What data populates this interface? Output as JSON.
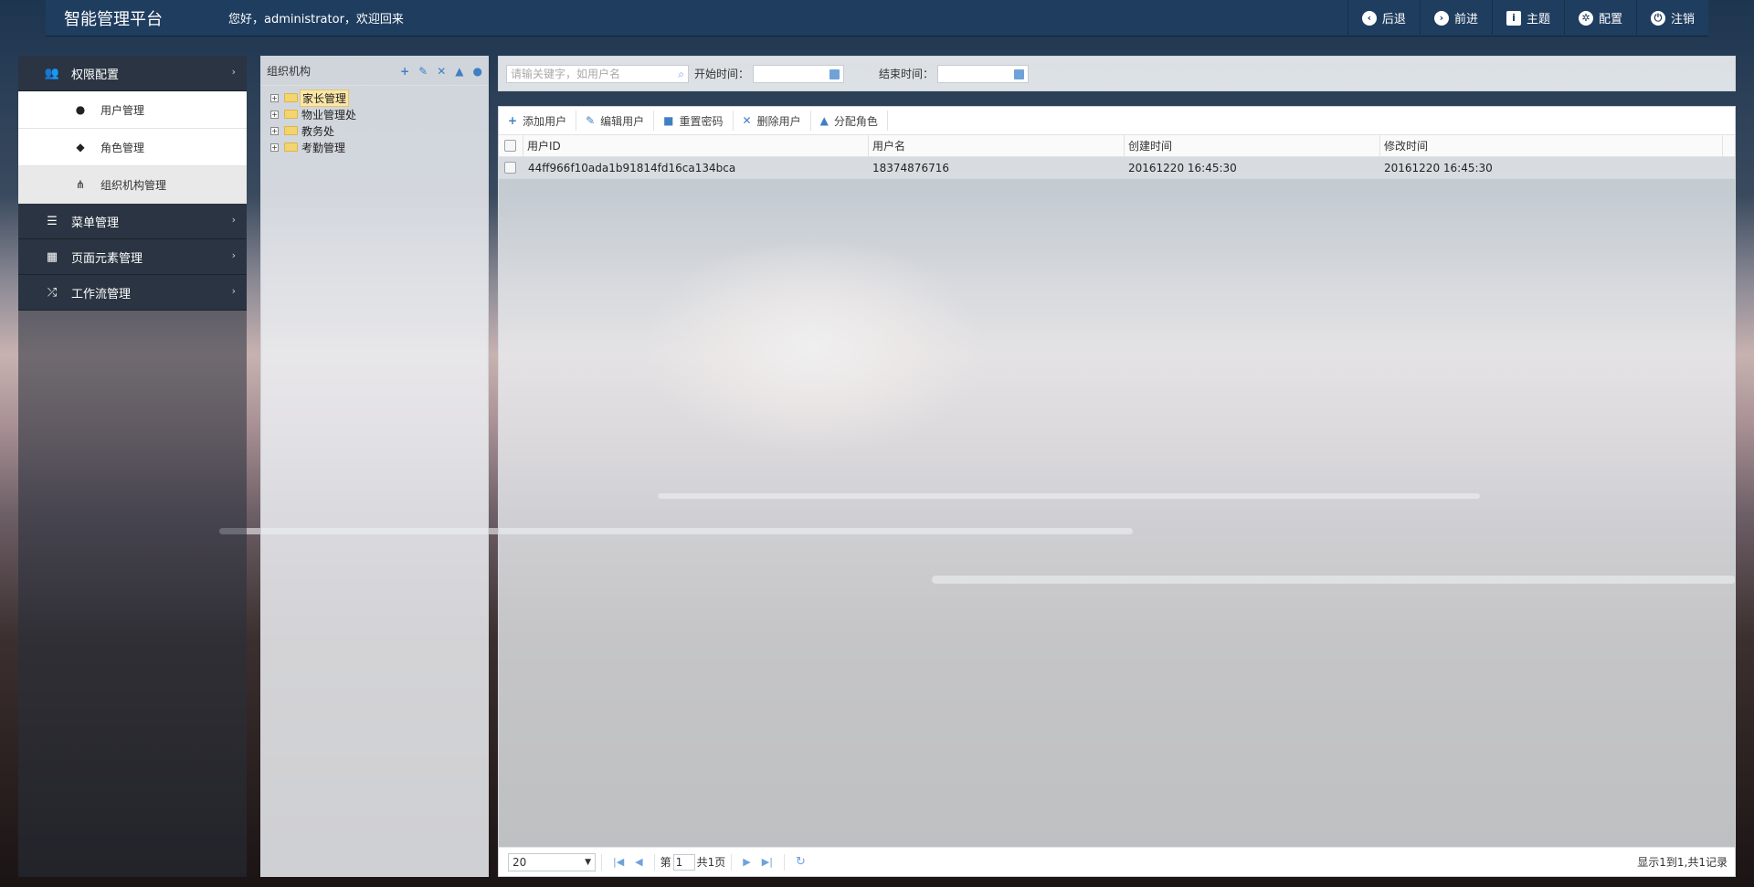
{
  "header": {
    "brand": "智能管理平台",
    "welcome": "您好，administrator，欢迎回来",
    "nav": [
      {
        "icon": "back-icon",
        "label": "后退"
      },
      {
        "icon": "forward-icon",
        "label": "前进"
      },
      {
        "icon": "theme-icon",
        "label": "主题"
      },
      {
        "icon": "gear-icon",
        "label": "配置"
      },
      {
        "icon": "power-icon",
        "label": "注销"
      }
    ]
  },
  "sidebar": {
    "group1": {
      "label": "权限配置",
      "icon": "users-icon"
    },
    "subitems": [
      {
        "label": "用户管理",
        "icon": "user-icon"
      },
      {
        "label": "角色管理",
        "icon": "graduation-cap-icon"
      },
      {
        "label": "组织机构管理",
        "icon": "sitemap-icon"
      }
    ],
    "group2": {
      "label": "菜单管理",
      "icon": "list-icon"
    },
    "group3": {
      "label": "页面元素管理",
      "icon": "grid-icon"
    },
    "group4": {
      "label": "工作流管理",
      "icon": "shuffle-icon"
    }
  },
  "tree": {
    "title": "组织机构",
    "nodes": [
      "家长管理",
      "物业管理处",
      "教务处",
      "考勤管理"
    ]
  },
  "search": {
    "placeholder": "请输关键字，如用户名",
    "start_label": "开始时间：",
    "end_label": "结束时间："
  },
  "toolbar": {
    "add": "添加用户",
    "edit": "编辑用户",
    "reset": "重置密码",
    "delete": "删除用户",
    "assign": "分配角色"
  },
  "table": {
    "columns": [
      "用户ID",
      "用户名",
      "创建时间",
      "修改时间"
    ],
    "rows": [
      [
        "44ff966f10ada1b91814fd16ca134bca",
        "18374876716",
        "20161220 16:45:30",
        "20161220 16:45:30"
      ]
    ]
  },
  "pager": {
    "page_size": "20",
    "page_prefix": "第",
    "page_value": "1",
    "page_total": "共1页",
    "info": "显示1到1,共1记录"
  },
  "colors": {
    "accent": "#3f7fc4",
    "header_bg": "#1f3d5f"
  }
}
